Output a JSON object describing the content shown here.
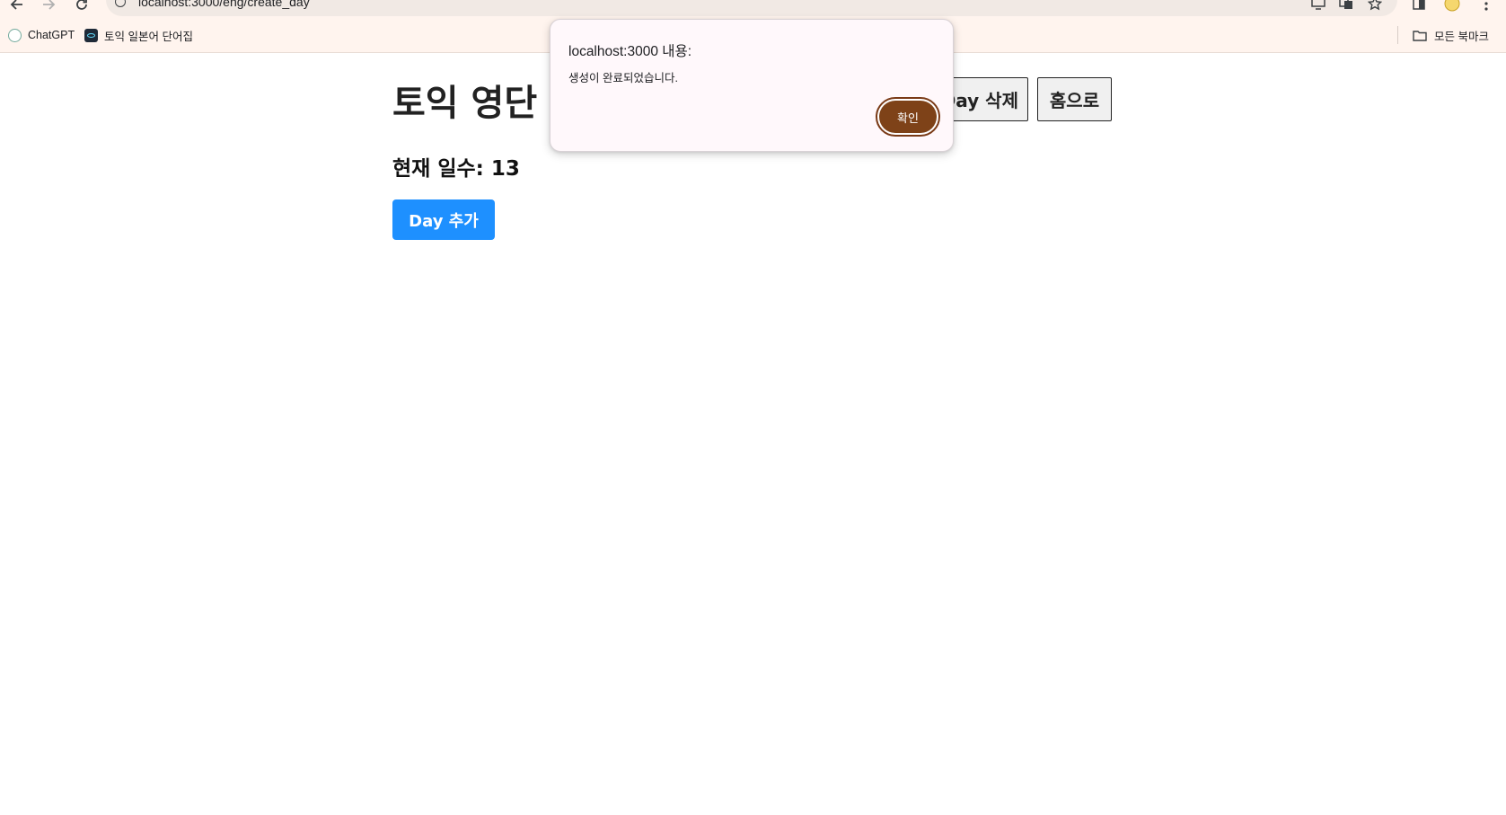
{
  "browser": {
    "url": "localhost:3000/eng/create_day",
    "bookmarks": [
      {
        "label": "ChatGPT",
        "icon": "chatgpt-favicon"
      },
      {
        "label": "토익 일본어 단어집",
        "icon": "react-favicon"
      }
    ],
    "all_bookmarks_label": "모든 북마크"
  },
  "page": {
    "title": "토익 영단",
    "delete_day_label": "Day 삭제",
    "home_label": "홈으로",
    "day_count_label": "현재 일수: ",
    "day_count_value": "13",
    "add_day_label": "Day 추가",
    "accent_color": "#1e90ff"
  },
  "dialog": {
    "title": "localhost:3000 내용:",
    "message": "생성이 완료되었습니다.",
    "ok_label": "확인",
    "ok_color": "#7e4218"
  }
}
